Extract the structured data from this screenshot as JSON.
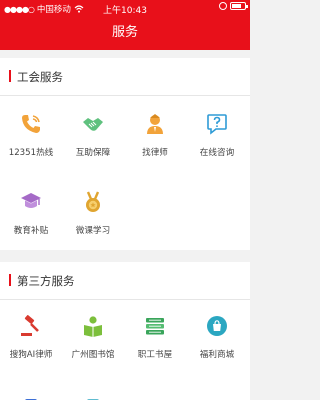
{
  "status_bar": {
    "carrier": "中国移动",
    "time": "上午10:43"
  },
  "header": {
    "title": "服务"
  },
  "sections": [
    {
      "title": "工会服务",
      "items": [
        {
          "label": "12351热线",
          "icon": "phone-icon",
          "color": "#f2a33a"
        },
        {
          "label": "互助保障",
          "icon": "handshake-icon",
          "color": "#5fc17e"
        },
        {
          "label": "找律师",
          "icon": "lawyer-icon",
          "color": "#f2a33a"
        },
        {
          "label": "在线咨询",
          "icon": "chat-question-icon",
          "color": "#2e9bd6"
        },
        {
          "label": "教育补贴",
          "icon": "graduation-cap-icon",
          "color": "#a56ac7"
        },
        {
          "label": "微课学习",
          "icon": "medal-icon",
          "color": "#e0a530"
        }
      ]
    },
    {
      "title": "第三方服务",
      "items": [
        {
          "label": "搜狗AI律师",
          "icon": "gavel-icon",
          "color": "#d93a2f"
        },
        {
          "label": "广州图书馆",
          "icon": "reader-icon",
          "color": "#7cbf3c"
        },
        {
          "label": "职工书屋",
          "icon": "books-icon",
          "color": "#3aa55b"
        },
        {
          "label": "福利商城",
          "icon": "shop-icon",
          "color": "#2ba7c1"
        }
      ]
    }
  ]
}
